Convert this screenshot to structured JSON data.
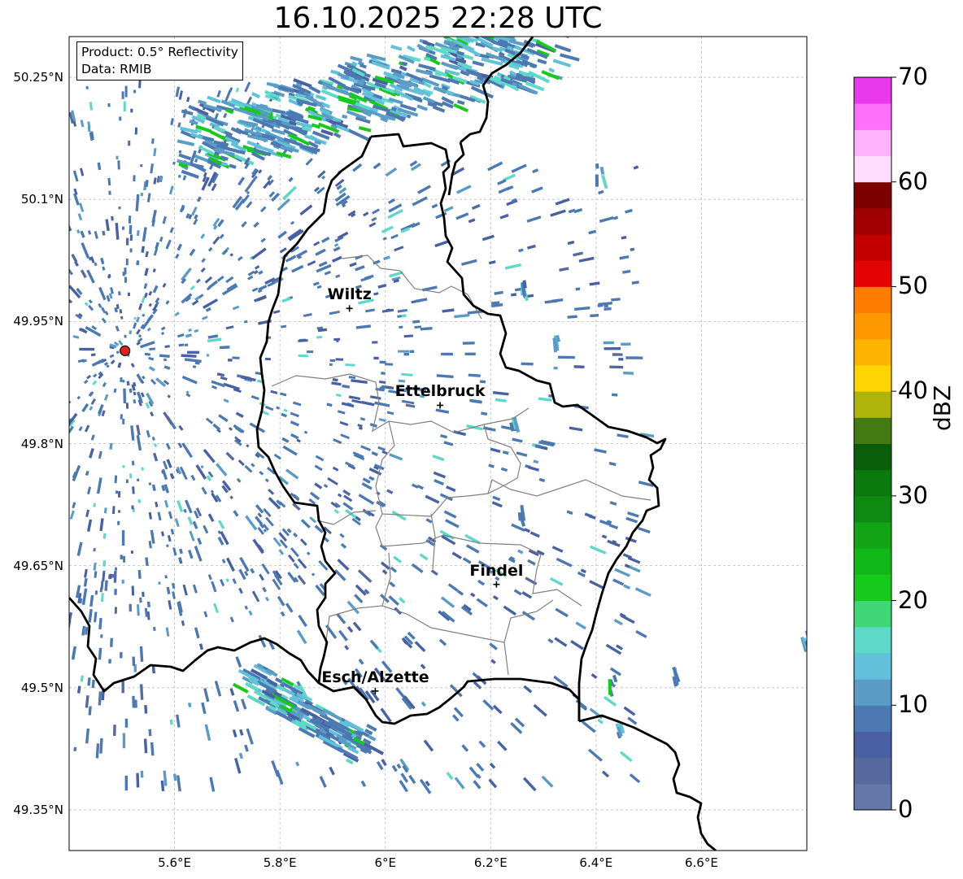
{
  "title": "16.10.2025 22:28 UTC",
  "info": {
    "product": "Product: 0.5° Reflectivity",
    "data": "Data: RMIB"
  },
  "axes": {
    "lat_ticks": [
      "50.25°N",
      "50.1°N",
      "49.95°N",
      "49.8°N",
      "49.65°N",
      "49.5°N",
      "49.35°N"
    ],
    "lon_ticks": [
      "5.6°E",
      "5.8°E",
      "6°E",
      "6.2°E",
      "6.4°E",
      "6.6°E"
    ],
    "lat_range": [
      49.3,
      50.3
    ],
    "lon_range": [
      5.4,
      6.8
    ]
  },
  "cities": [
    {
      "name": "Wiltz",
      "lat": 49.966,
      "lon": 5.932
    },
    {
      "name": "Ettelbruck",
      "lat": 49.847,
      "lon": 6.104
    },
    {
      "name": "Findel",
      "lat": 49.627,
      "lon": 6.211
    },
    {
      "name": "Esch/Alzette",
      "lat": 49.496,
      "lon": 5.981
    }
  ],
  "radar_site": {
    "lat": 49.914,
    "lon": 5.506,
    "color": "#e0201a"
  },
  "colorbar": {
    "label": "dBZ",
    "ticks": [
      "0",
      "10",
      "20",
      "30",
      "40",
      "50",
      "60",
      "70"
    ],
    "min": 0,
    "max": 70,
    "step": 2.5,
    "colors": [
      "#6576a8",
      "#566aa0",
      "#4960a2",
      "#4c79b2",
      "#5b9cc7",
      "#62c0da",
      "#5ed8c8",
      "#3fd675",
      "#16c91a",
      "#10b81a",
      "#12a415",
      "#0f8a11",
      "#0b7a0e",
      "#0a5e0a",
      "#447a12",
      "#b0b40a",
      "#fdd500",
      "#fcb400",
      "#fd9800",
      "#fe7c00",
      "#e50404",
      "#c20000",
      "#a10000",
      "#7c0000",
      "#ffdcfe",
      "#ffb4fe",
      "#fe6ffa",
      "#ea38ec"
    ]
  }
}
